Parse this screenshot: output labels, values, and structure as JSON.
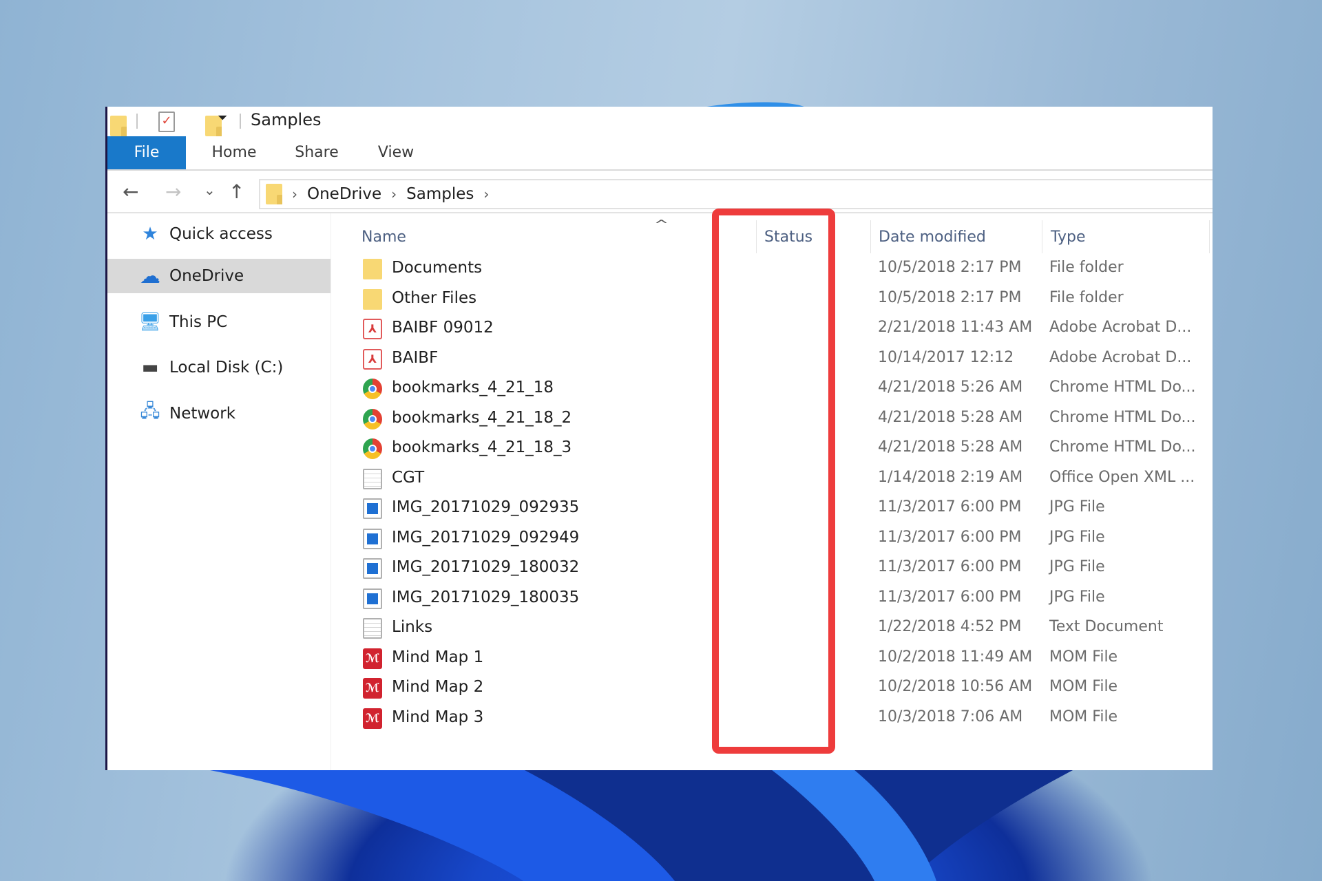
{
  "window": {
    "title": "Samples",
    "quick_access_toolbar": [
      "folder-icon",
      "properties-icon",
      "new-folder-icon",
      "customize-dropdown-icon"
    ]
  },
  "ribbon": {
    "tabs": [
      {
        "label": "File",
        "active": true
      },
      {
        "label": "Home"
      },
      {
        "label": "Share"
      },
      {
        "label": "View"
      }
    ]
  },
  "navigation": {
    "back_icon": "←",
    "forward_icon": "→",
    "recent_icon": "⌄",
    "up_icon": "↑",
    "breadcrumb": [
      "OneDrive",
      "Samples"
    ],
    "separator": "›"
  },
  "sidebar": {
    "items": [
      {
        "label": "Quick access",
        "icon": "star-icon",
        "glyph": "★",
        "color": "#2f84dc"
      },
      {
        "label": "OneDrive",
        "icon": "cloud-icon",
        "glyph": "☁",
        "color": "#1f6fd1",
        "selected": true
      },
      {
        "label": "This PC",
        "icon": "monitor-icon",
        "glyph": "🖥",
        "color": "#3aa0e8"
      },
      {
        "label": "Local Disk (C:)",
        "icon": "drive-icon",
        "glyph": "▬",
        "color": "#444444"
      },
      {
        "label": "Network",
        "icon": "network-icon",
        "glyph": "🖧",
        "color": "#3a8ad8"
      }
    ]
  },
  "file_list": {
    "columns": {
      "name": "Name",
      "status": "Status",
      "date": "Date modified",
      "type": "Type"
    },
    "sort_indicator": "^",
    "rows": [
      {
        "name": "Documents",
        "icon": "folder",
        "date": "10/5/2018 2:17 PM",
        "type": "File folder"
      },
      {
        "name": "Other Files",
        "icon": "folder",
        "date": "10/5/2018 2:17 PM",
        "type": "File folder"
      },
      {
        "name": "BAIBF 09012",
        "icon": "pdf",
        "date": "2/21/2018 11:43 AM",
        "type": "Adobe Acrobat D..."
      },
      {
        "name": "BAIBF",
        "icon": "pdf",
        "date": "10/14/2017 12:12",
        "type": "Adobe Acrobat D..."
      },
      {
        "name": "bookmarks_4_21_18",
        "icon": "chrome",
        "date": "4/21/2018 5:26 AM",
        "type": "Chrome HTML Do..."
      },
      {
        "name": "bookmarks_4_21_18_2",
        "icon": "chrome",
        "date": "4/21/2018 5:28 AM",
        "type": "Chrome HTML Do..."
      },
      {
        "name": "bookmarks_4_21_18_3",
        "icon": "chrome",
        "date": "4/21/2018 5:28 AM",
        "type": "Chrome HTML Do..."
      },
      {
        "name": "CGT",
        "icon": "doc",
        "date": "1/14/2018 2:19 AM",
        "type": "Office Open XML ..."
      },
      {
        "name": "IMG_20171029_092935",
        "icon": "img",
        "date": "11/3/2017 6:00 PM",
        "type": "JPG File"
      },
      {
        "name": "IMG_20171029_092949",
        "icon": "img",
        "date": "11/3/2017 6:00 PM",
        "type": "JPG File"
      },
      {
        "name": "IMG_20171029_180032",
        "icon": "img",
        "date": "11/3/2017 6:00 PM",
        "type": "JPG File"
      },
      {
        "name": "IMG_20171029_180035",
        "icon": "img",
        "date": "11/3/2017 6:00 PM",
        "type": "JPG File"
      },
      {
        "name": "Links",
        "icon": "doc",
        "date": "1/22/2018 4:52 PM",
        "type": "Text Document"
      },
      {
        "name": "Mind Map 1",
        "icon": "mom",
        "date": "10/2/2018 11:49 AM",
        "type": "MOM File"
      },
      {
        "name": "Mind Map 2",
        "icon": "mom",
        "date": "10/2/2018 10:56 AM",
        "type": "MOM File"
      },
      {
        "name": "Mind Map 3",
        "icon": "mom",
        "date": "10/3/2018 7:06 AM",
        "type": "MOM File"
      }
    ]
  },
  "annotation": {
    "target": "Status column",
    "color": "#ee3c3c"
  },
  "icon_glyphs": {
    "pdf": "⅄",
    "mom": "ℳ",
    "customize": "⏷",
    "check": "✓"
  }
}
